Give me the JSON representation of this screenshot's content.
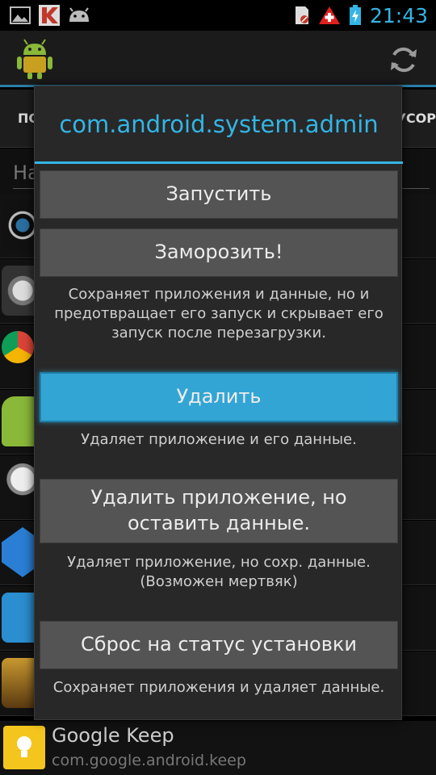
{
  "status_bar": {
    "time": "21:43",
    "icons": [
      "gallery-icon",
      "kaspersky-icon",
      "android-debug-icon",
      "sd-card-icon",
      "warning-icon",
      "battery-charging-icon"
    ]
  },
  "action_bar": {
    "logo_icon": "android-robot-logo-icon",
    "refresh_icon": "refresh-icon"
  },
  "tabs": {
    "left_label": "ПО",
    "right_label": "УСОР"
  },
  "search": {
    "placeholder": "На"
  },
  "background_list": {
    "last_app": {
      "name": "Google Keep",
      "package": "com.google.android.keep"
    }
  },
  "dialog": {
    "title": "com.android.system.admin",
    "run_button": "Запустить",
    "freeze_button": "Заморозить!",
    "freeze_description": "Сохраняет приложения и данные, но и предотвращает его запуск и скрывает его запуск после перезагрузки.",
    "uninstall_button": "Удалить",
    "uninstall_description": "Удаляет приложение и его данные.",
    "uninstall_keep_data_button": "Удалить приложение, но оставить данные.",
    "uninstall_keep_data_description": "Удаляет приложение, но сохр. данные. (Возможен мертвяк)",
    "reset_button": "Сброс на статус установки",
    "reset_description": "Сохраняет приложения и удаляет данные."
  },
  "colors": {
    "accent": "#33b5e5",
    "primary_button": "#33a5d5",
    "dialog_bg": "#282828",
    "button_bg": "#545454"
  }
}
